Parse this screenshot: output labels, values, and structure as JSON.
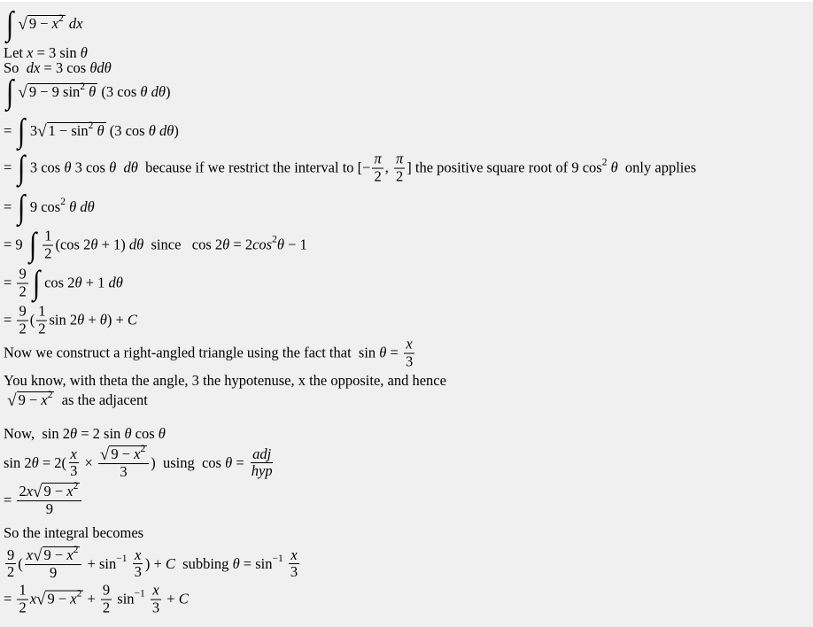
{
  "document": {
    "lines": [
      [
        {
          "int": 1
        },
        {
          "sqrt": [
            "9 − ",
            {
              "i": "x"
            },
            {
              "sup": "2"
            }
          ]
        },
        " ",
        {
          "i": "dx"
        }
      ],
      [
        "Let ",
        {
          "i": "x"
        },
        " = 3 sin ",
        {
          "i": "θ"
        }
      ],
      [
        "So  ",
        {
          "i": "dx"
        },
        " = 3 cos ",
        {
          "i": "θdθ"
        }
      ],
      [
        {
          "int": 1
        },
        {
          "sqrt": [
            "9 − 9 sin",
            {
              "sup": "2"
            },
            " ",
            {
              "i": "θ"
            }
          ]
        },
        " (3 cos ",
        {
          "i": "θ dθ"
        },
        ")"
      ],
      [
        "= ",
        {
          "int": 1
        },
        "3",
        {
          "sqrt": [
            "1 − sin",
            {
              "sup": "2"
            },
            " ",
            {
              "i": "θ"
            }
          ]
        },
        " (3 cos ",
        {
          "i": "θ dθ"
        },
        ")"
      ],
      [
        "= ",
        {
          "int": 1
        },
        "3 cos ",
        {
          "i": "θ"
        },
        " 3 cos ",
        {
          "i": "θ"
        },
        "  ",
        {
          "i": "dθ"
        },
        "  because if we restrict the interval to [−",
        {
          "frac": [
            [
              {
                "i": "π"
              }
            ],
            [
              "2"
            ]
          ]
        },
        ", ",
        {
          "frac": [
            [
              {
                "i": "π"
              }
            ],
            [
              "2"
            ]
          ]
        },
        "] the positive square root of 9 cos",
        {
          "sup": "2"
        },
        " ",
        {
          "i": "θ"
        },
        "  only applies"
      ],
      [
        "= ",
        {
          "int": 1
        },
        "9 cos",
        {
          "sup": "2"
        },
        " ",
        {
          "i": "θ dθ"
        }
      ],
      [
        "= 9 ",
        {
          "int": 1
        },
        {
          "frac": [
            [
              "1"
            ],
            [
              "2"
            ]
          ]
        },
        "(cos 2",
        {
          "i": "θ"
        },
        " + 1) ",
        {
          "i": "dθ"
        },
        "  since   cos 2",
        {
          "i": "θ"
        },
        " = 2",
        {
          "i": "cos"
        },
        {
          "sup": "2"
        },
        {
          "i": "θ"
        },
        " − 1"
      ],
      [
        "= ",
        {
          "frac": [
            [
              "9"
            ],
            [
              "2"
            ]
          ]
        },
        {
          "int": 1
        },
        "cos 2",
        {
          "i": "θ"
        },
        " + 1 ",
        {
          "i": "dθ"
        }
      ],
      [
        "= ",
        {
          "frac": [
            [
              "9"
            ],
            [
              "2"
            ]
          ]
        },
        "(",
        {
          "frac": [
            [
              "1"
            ],
            [
              "2"
            ]
          ]
        },
        "sin 2",
        {
          "i": "θ"
        },
        " + ",
        {
          "i": "θ"
        },
        ") + ",
        {
          "i": "C"
        }
      ],
      [
        "Now we construct a right-angled triangle using the fact that  sin ",
        {
          "i": "θ"
        },
        " = ",
        {
          "frac": [
            [
              {
                "i": "x"
              }
            ],
            [
              "3"
            ]
          ]
        }
      ],
      [
        "You know, with theta the angle, 3 the hypotenuse, x the opposite, and hence"
      ],
      [
        " ",
        {
          "sqrt": [
            "9 − ",
            {
              "i": "x"
            },
            {
              "sup": "2"
            }
          ]
        },
        "  as the adjacent"
      ],
      [
        "Now,  sin 2",
        {
          "i": "θ"
        },
        " = 2 sin ",
        {
          "i": "θ"
        },
        " cos ",
        {
          "i": "θ"
        }
      ],
      [
        "sin 2",
        {
          "i": "θ"
        },
        " = 2(",
        {
          "frac": [
            [
              {
                "i": "x"
              }
            ],
            [
              "3"
            ]
          ]
        },
        " × ",
        {
          "frac": [
            [
              {
                "sqrt": [
                  "9 − ",
                  {
                    "i": "x"
                  },
                  {
                    "sup": "2"
                  }
                ]
              }
            ],
            [
              "3"
            ]
          ]
        },
        ")  using  cos ",
        {
          "i": "θ"
        },
        " = ",
        {
          "frac": [
            [
              {
                "i": "adj"
              }
            ],
            [
              {
                "i": "hyp"
              }
            ]
          ]
        }
      ],
      [
        "= ",
        {
          "frac": [
            [
              "2",
              {
                "i": "x"
              },
              {
                "sqrt": [
                  "9 − ",
                  {
                    "i": "x"
                  },
                  {
                    "sup": "2"
                  }
                ]
              }
            ],
            [
              "9"
            ]
          ]
        }
      ],
      [
        "So the integral becomes"
      ],
      [
        {
          "frac": [
            [
              "9"
            ],
            [
              "2"
            ]
          ]
        },
        "(",
        {
          "frac": [
            [
              {
                "i": "x"
              },
              {
                "sqrt": [
                  "9 − ",
                  {
                    "i": "x"
                  },
                  {
                    "sup": "2"
                  }
                ]
              }
            ],
            [
              "9"
            ]
          ]
        },
        " + sin",
        {
          "sup": "−1"
        },
        " ",
        {
          "frac": [
            [
              {
                "i": "x"
              }
            ],
            [
              "3"
            ]
          ]
        },
        ") + ",
        {
          "i": "C"
        },
        "  subbing ",
        {
          "i": "θ"
        },
        " = sin",
        {
          "sup": "−1"
        },
        " ",
        {
          "frac": [
            [
              {
                "i": "x"
              }
            ],
            [
              "3"
            ]
          ]
        }
      ],
      [
        "= ",
        {
          "frac": [
            [
              "1"
            ],
            [
              "2"
            ]
          ]
        },
        {
          "i": "x"
        },
        {
          "sqrt": [
            "9 − ",
            {
              "i": "x"
            },
            {
              "sup": "2"
            }
          ]
        },
        " + ",
        {
          "frac": [
            [
              "9"
            ],
            [
              "2"
            ]
          ]
        },
        " sin",
        {
          "sup": "−1"
        },
        " ",
        {
          "frac": [
            [
              {
                "i": "x"
              }
            ],
            [
              "3"
            ]
          ]
        },
        " + ",
        {
          "i": "C"
        }
      ]
    ]
  }
}
